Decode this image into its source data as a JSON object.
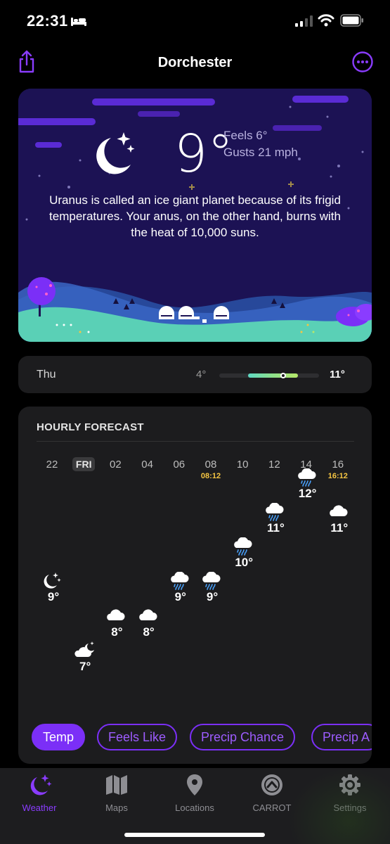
{
  "status": {
    "time": "22:31"
  },
  "header": {
    "title": "Dorchester",
    "share_icon": "share-icon",
    "more_icon": "more-icon"
  },
  "hero": {
    "temp": "9°",
    "feels_like": "Feels 6°",
    "gusts": "Gusts 21 mph",
    "quip": "Uranus is called an ice giant planet because of its frigid temperatures. Your anus, on the other hand, burns with the heat of 10,000 suns."
  },
  "daily": {
    "day": "Thu",
    "low": "4°",
    "high": "11°",
    "low_value": 4,
    "high_value": 11,
    "current_value": 9
  },
  "hourly": {
    "title": "HOURLY FORECAST",
    "hours": [
      {
        "label": "22",
        "icon": "moon-stars-icon",
        "temp": "9°",
        "value": 9
      },
      {
        "label": "FRI",
        "icon": "moon-cloud-icon",
        "temp": "7°",
        "value": 7
      },
      {
        "label": "02",
        "icon": "cloud-icon",
        "temp": "8°",
        "value": 8
      },
      {
        "label": "04",
        "icon": "cloud-icon",
        "temp": "8°",
        "value": 8
      },
      {
        "label": "06",
        "icon": "cloud-rain-icon",
        "temp": "9°",
        "value": 9
      },
      {
        "label": "08",
        "icon": "cloud-rain-icon",
        "temp": "9°",
        "value": 9,
        "sun": "08:12"
      },
      {
        "label": "10",
        "icon": "cloud-rain-icon",
        "temp": "10°",
        "value": 10
      },
      {
        "label": "12",
        "icon": "cloud-rain-icon",
        "temp": "11°",
        "value": 11
      },
      {
        "label": "14",
        "icon": "cloud-rain-icon",
        "temp": "12°",
        "value": 12
      },
      {
        "label": "16",
        "icon": "cloud-icon",
        "temp": "11°",
        "value": 11,
        "sun": "16:12"
      }
    ],
    "tabs": [
      "Temp",
      "Feels Like",
      "Precip Chance",
      "Precip A"
    ]
  },
  "tabbar": [
    {
      "label": "Weather",
      "icon": "weather-icon",
      "active": true
    },
    {
      "label": "Maps",
      "icon": "map-icon",
      "active": false
    },
    {
      "label": "Locations",
      "icon": "location-pin-icon",
      "active": false
    },
    {
      "label": "CARROT",
      "icon": "carrot-icon",
      "active": false
    },
    {
      "label": "Settings",
      "icon": "gear-icon",
      "active": false
    }
  ],
  "colors": {
    "accent": "#7b2ff7",
    "card": "#1c1c1e",
    "hero_sky": "#1c1254",
    "sun_time": "#f5c542"
  }
}
